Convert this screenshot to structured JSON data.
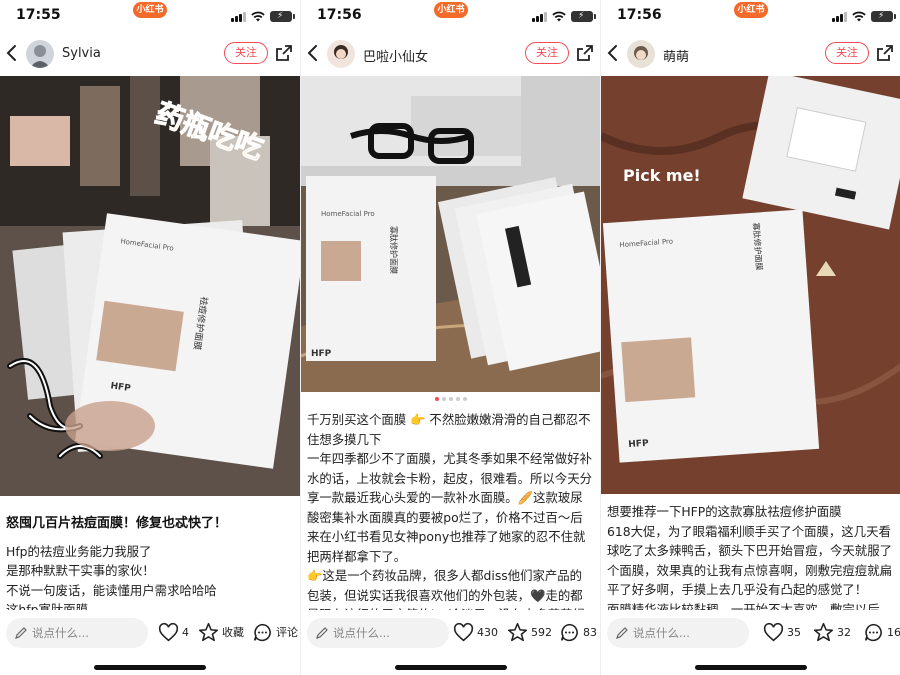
{
  "status_pill": "小红书",
  "posts": [
    {
      "time": "17:55",
      "user": "Sylvia",
      "follow_label": "关注",
      "photo_text": [
        "HomeFacial Pro",
        "HFP",
        "祛痘修护面膜"
      ],
      "photo_overlay": "药瓶吃吃",
      "title": "怒囤几百片祛痘面膜！修复也忒快了！",
      "lines": [
        "Hfp的祛痘业务能力我服了",
        "是那种默默干实事的家伙！",
        "不说一句废话，能读懂用户需求哈哈哈",
        "这hfp寡肽面膜"
      ],
      "comment_placeholder": "说点什么...",
      "like_count": "4",
      "collect_label": "收藏",
      "comment_label": "评论"
    },
    {
      "time": "17:56",
      "user": "巴啦小仙女",
      "follow_label": "关注",
      "photo_text": [
        "HomeFacial Pro",
        "HFP",
        "寡肽修护面膜"
      ],
      "title": "",
      "lines": [
        "千万别买这个面膜 👉 不然脸嫩嫩滑滑的自己都忍不住想多摸几下",
        "一年四季都少不了面膜，尤其冬季如果不经常做好补水的话，上妆就会卡粉，起皮，很难看。所以今天分享一款最近我心头爱的一款补水面膜。🥖这款玻尿酸密集补水面膜真的要被po烂了，价格不过百～后来在小红书看见女神pony也推荐了她家的忍不住就把两样都拿下了。",
        "👉这是一个药妆品牌，很多人都diss他们家产品的包装，但说实话我很喜欢他们的外包装，🖤走的都是现在流行的周户简约ins冷淡风，没有太多花花绿绿的东西，看"
      ],
      "comment_placeholder": "说点什么...",
      "like_count": "430",
      "collect_count": "592",
      "comment_count": "83"
    },
    {
      "time": "17:56",
      "user": "萌萌",
      "follow_label": "关注",
      "photo_text": [
        "HomeFacial Pro",
        "HFP",
        "寡肽修护面膜",
        "Pick me!"
      ],
      "title": "",
      "lines": [
        "想要推荐一下HFP的这款寡肽祛痘修护面膜",
        "618大促，为了眼霜福利顺手买了个面膜，这几天看球吃了太多辣鸭舌，额头下巴开始冒痘，今天就服了个面膜，效果真的让我有点惊喜啊，刚敷完痘痘就扁平了好多啊，手摸上去几乎没有凸起的感觉了！",
        "面膜精华液比较黏稠，一开始不太喜欢，敷完以后，接"
      ],
      "comment_placeholder": "说点什么...",
      "like_count": "35",
      "collect_count": "32",
      "comment_count": "16"
    }
  ]
}
